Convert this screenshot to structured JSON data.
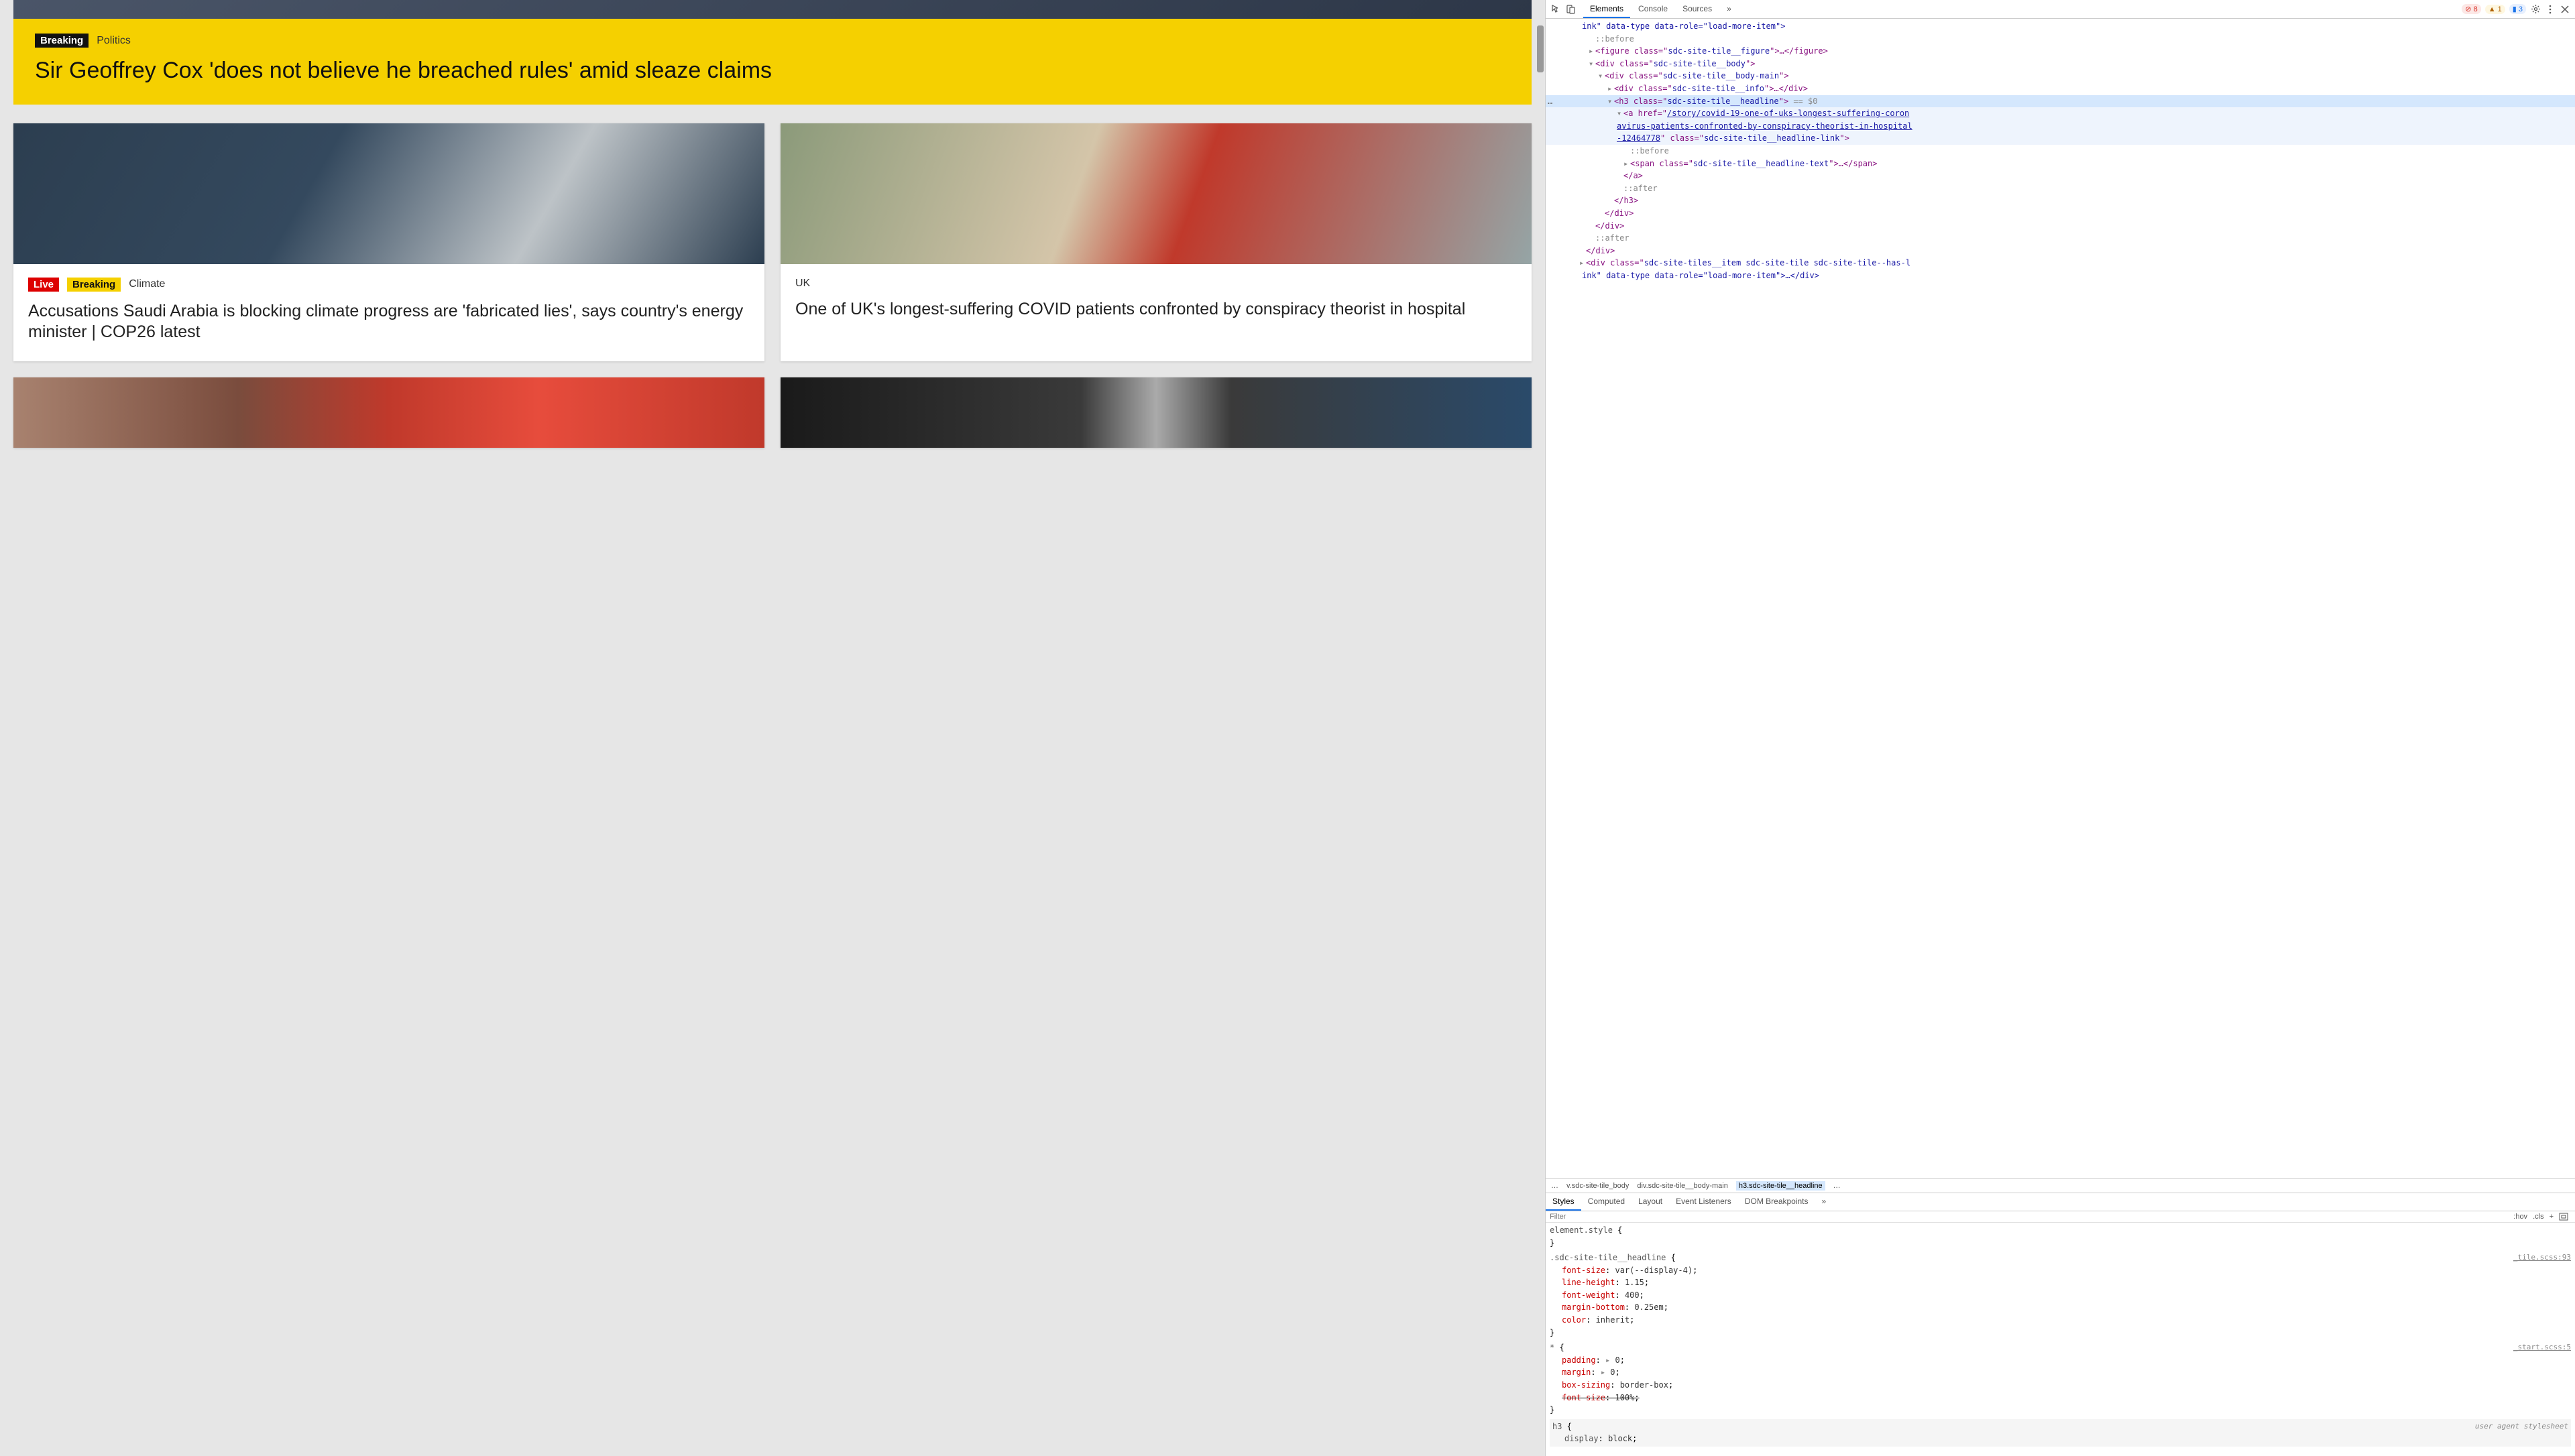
{
  "hero": {
    "breaking_tag": "Breaking",
    "category": "Politics",
    "headline": "Sir Geoffrey Cox 'does not believe he breached rules' amid sleaze claims"
  },
  "cards": {
    "a": {
      "live": "Live",
      "breaking": "Breaking",
      "category": "Climate",
      "headline": "Accusations Saudi Arabia is blocking climate progress are 'fabricated lies', says country's energy minister | COP26 latest"
    },
    "b": {
      "category": "UK",
      "headline": "One of UK's longest-suffering COVID patients confronted by conspiracy theorist in hospital"
    }
  },
  "devtools": {
    "tabs": {
      "elements": "Elements",
      "console": "Console",
      "sources": "Sources"
    },
    "badges": {
      "errors": "8",
      "warnings": "1",
      "info": "3"
    },
    "more": "»",
    "dom": {
      "l0": "ink\" data-type data-role=\"load-more-item\">",
      "l1": "::before",
      "l2a": "<figure class=\"",
      "l2b": "sdc-site-tile__figure",
      "l2c": "\">…</figure>",
      "l3a": "<div class=\"",
      "l3b": "sdc-site-tile__body",
      "l3c": "\">",
      "l4a": "<div class=\"",
      "l4b": "sdc-site-tile__body-main",
      "l4c": "\">",
      "l5a": "<div class=\"",
      "l5b": "sdc-site-tile__info",
      "l5c": "\">…</div>",
      "l6a": "<h3 class=\"",
      "l6b": "sdc-site-tile__headline",
      "l6c": "\">",
      "l6d": " == $0",
      "l7a": "<a href=\"",
      "l7b": "/story/covid-19-one-of-uks-longest-suffering-coron",
      "l7c": "avirus-patients-confronted-by-conspiracy-theorist-in-hospital",
      "l7d": "-12464778",
      "l7e": "\" class=\"",
      "l7f": "sdc-site-tile__headline-link",
      "l7g": "\">",
      "l8": "::before",
      "l9a": "<span class=\"",
      "l9b": "sdc-site-tile__headline-text",
      "l9c": "\">…</span>",
      "l10": "</a>",
      "l11": "::after",
      "l12": "</h3>",
      "l13": "</div>",
      "l14": "</div>",
      "l15": "::after",
      "l16": "</div>",
      "l17a": "<div class=\"",
      "l17b": "sdc-site-tiles__item sdc-site-tile sdc-site-tile--has-l",
      "l17c": "ink\" data-type data-role=\"load-more-item\">…</div>",
      "dots": "…"
    },
    "breadcrumb": {
      "dots": "…",
      "c1": "v.sdc-site-tile_body",
      "c2": "div.sdc-site-tile__body-main",
      "c3": "h3.sdc-site-tile__headline",
      "c4": "…"
    },
    "styles_tabs": {
      "styles": "Styles",
      "computed": "Computed",
      "layout": "Layout",
      "listeners": "Event Listeners",
      "dom_bp": "DOM Breakpoints"
    },
    "filter": {
      "placeholder": "Filter",
      "hov": ":hov",
      "cls": ".cls"
    },
    "rules": {
      "r0": {
        "sel": "element.style",
        "open": " {",
        "close": "}"
      },
      "r1": {
        "sel": ".sdc-site-tile__headline",
        "open": " {",
        "close": "}",
        "src": "_tile.scss:93",
        "p1n": "font-size",
        "p1v": "var(--display-4)",
        "p2n": "line-height",
        "p2v": "1.15",
        "p3n": "font-weight",
        "p3v": "400",
        "p4n": "margin-bottom",
        "p4v": "0.25em",
        "p5n": "color",
        "p5v": "inherit"
      },
      "r2": {
        "sel": "*",
        "open": " {",
        "close": "}",
        "src": "_start.scss:5",
        "p1n": "padding",
        "p1v": "0",
        "p1arrow": "▸",
        "p2n": "margin",
        "p2v": "0",
        "p2arrow": "▸",
        "p3n": "box-sizing",
        "p3v": "border-box",
        "p4n": "font-size",
        "p4v": "100%"
      },
      "r3": {
        "sel": "h3",
        "open": " {",
        "note": "user agent stylesheet",
        "p1n": "display",
        "p1v": "block"
      }
    }
  }
}
